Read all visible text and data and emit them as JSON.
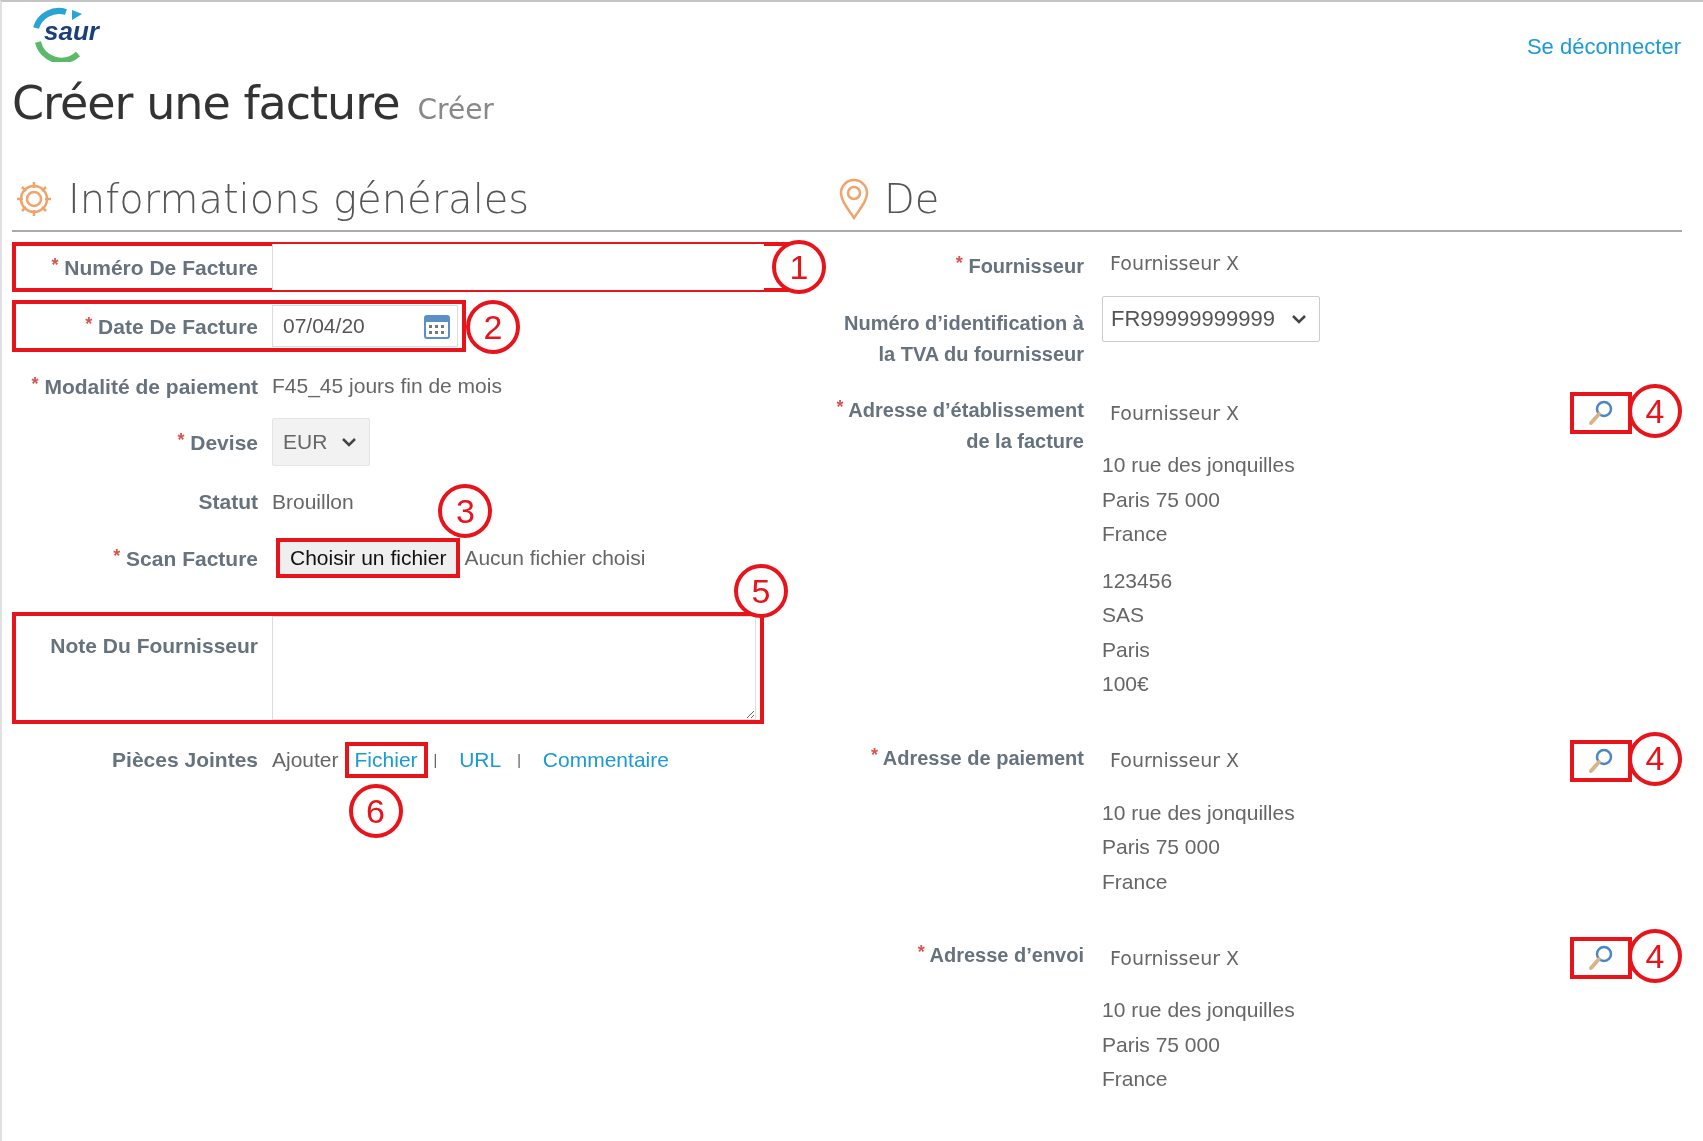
{
  "header": {
    "logo": "saur",
    "logout": "Se déconnecter",
    "title": "Créer une facture",
    "subtitle": "Créer"
  },
  "general": {
    "title": "Informations générales",
    "fields": [
      {
        "kind": "input",
        "required_mark": "*",
        "label": "Numéro De Facture",
        "callout": "1"
      },
      {
        "kind": "date",
        "required_mark": "*",
        "label": "Date De Facture",
        "value": "07/04/20",
        "callout": "2"
      },
      {
        "kind": "text",
        "required_mark": "*",
        "label": "Modalité de paiement",
        "value": "F45_45 jours fin de mois"
      },
      {
        "kind": "select",
        "required_mark": "*",
        "label": "Devise",
        "value": "EUR"
      },
      {
        "kind": "text",
        "label": "Statut",
        "value": "Brouillon"
      },
      {
        "kind": "file",
        "required_mark": "*",
        "label": "Scan Facture",
        "button": "Choisir un fichier",
        "value": "Aucun fichier choisi",
        "callout": "3"
      },
      {
        "kind": "textarea",
        "label": "Note Du Fournisseur",
        "callout": "5"
      },
      {
        "kind": "attachments",
        "label": "Pièces Jointes",
        "prefix": "Ajouter",
        "links": [
          {
            "text": "Fichier",
            "callout": "6"
          },
          {
            "separator": "|",
            "text": "URL"
          },
          {
            "separator": "|",
            "text": "Commentaire"
          }
        ]
      }
    ]
  },
  "from": {
    "title": "De",
    "fields": [
      {
        "kind": "text",
        "required_mark": "*",
        "label": "Fournisseur",
        "value": "Fournisseur X"
      },
      {
        "kind": "select",
        "label": "Numéro d’identification à la TVA du fournisseur",
        "value": "FR99999999999"
      },
      {
        "kind": "address",
        "required_mark": "*",
        "label": "Adresse d’établissement de la facture",
        "value": "Fournisseur X",
        "callout": "4",
        "lines": [
          "10 rue des jonquilles",
          "Paris 75 000",
          "France"
        ],
        "extra": [
          "123456",
          "SAS",
          "Paris",
          "100€"
        ]
      },
      {
        "kind": "address",
        "required_mark": "*",
        "label": "Adresse de paiement",
        "value": "Fournisseur X",
        "callout": "4",
        "lines": [
          "10 rue des jonquilles",
          "Paris 75 000",
          "France"
        ]
      },
      {
        "kind": "address",
        "required_mark": "*",
        "label": "Adresse d’envoi",
        "value": "Fournisseur X",
        "callout": "4",
        "lines": [
          "10 rue des jonquilles",
          "Paris 75 000",
          "France"
        ]
      }
    ]
  }
}
